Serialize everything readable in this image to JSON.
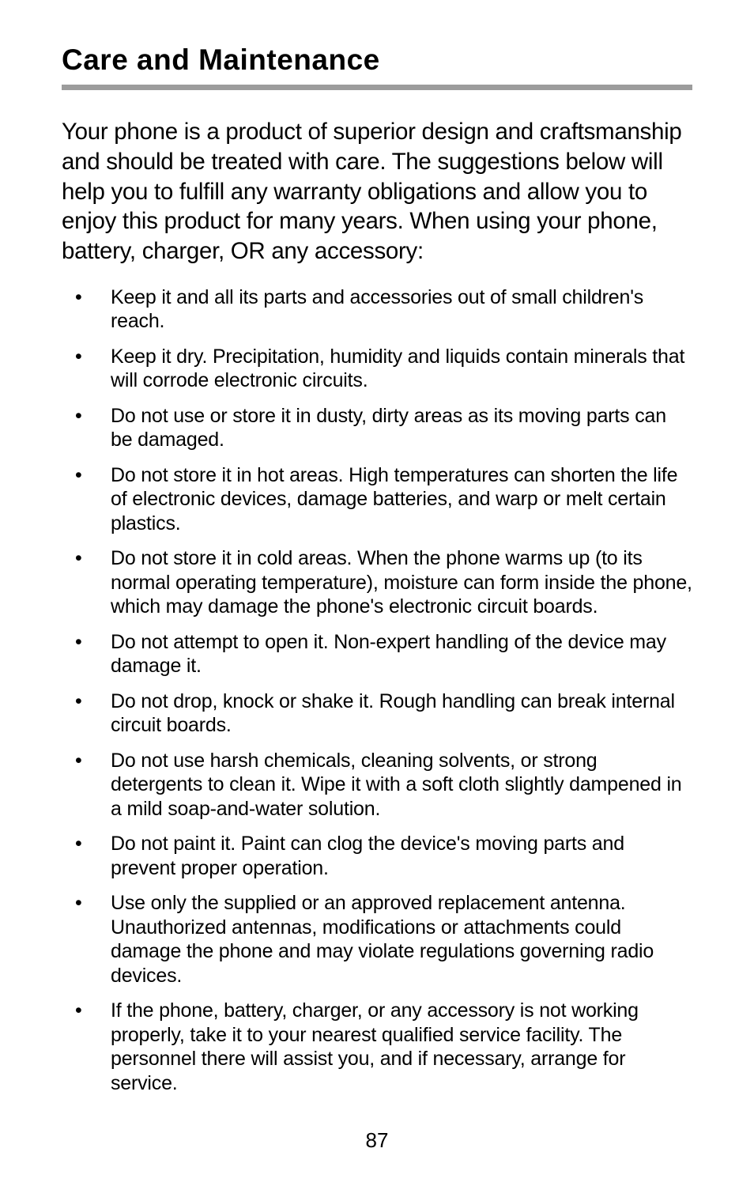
{
  "title": "Care and Maintenance",
  "intro": "Your phone is a product of superior design and craftsmanship and should be treated with care. The suggestions below will help you to fulfill any warranty obligations and allow you to enjoy this product for many years. When using your phone, battery, charger, OR any accessory:",
  "bullets": [
    "Keep it and all its parts and accessories out of small children's reach.",
    "Keep it dry. Precipitation, humidity and liquids contain minerals that will corrode electronic circuits.",
    "Do not use or store it in dusty, dirty areas as its moving parts can be damaged.",
    "Do not store it in hot areas. High temperatures can shorten the life of electronic devices, damage batteries, and warp or melt certain plastics.",
    "Do not store it in cold areas. When the phone warms up (to its normal operating temperature), moisture can form inside the phone, which may damage the phone's electronic circuit boards.",
    "Do not attempt to open it. Non-expert handling of the device may damage it.",
    "Do not drop, knock or shake it. Rough handling can break internal circuit boards.",
    "Do not use harsh chemicals, cleaning solvents, or strong detergents to clean it. Wipe it with a soft cloth slightly dampened in a mild soap-and-water solution.",
    "Do not paint it. Paint can clog the device's moving parts and prevent proper operation.",
    "Use only the supplied or an approved replacement antenna. Unauthorized antennas, modifications or attachments could damage the phone and may violate regulations governing radio devices.",
    "If the phone, battery, charger, or any accessory is not working properly, take it to your nearest qualified service facility. The personnel there will assist you, and if necessary, arrange for service."
  ],
  "page_number": "87"
}
